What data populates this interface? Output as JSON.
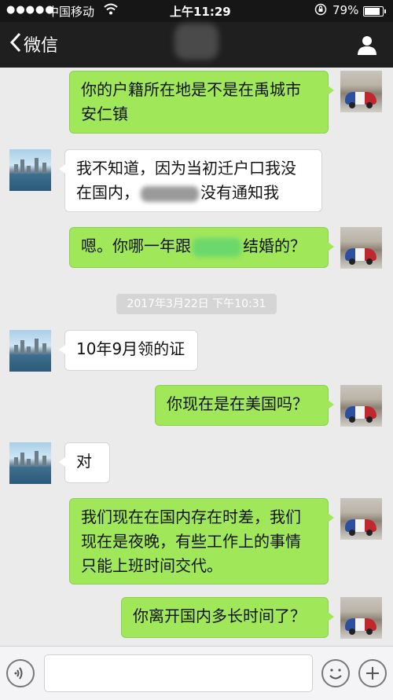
{
  "status_bar": {
    "signal": "●●●●●",
    "carrier": "中国移动",
    "time": "上午11:29",
    "battery": "79%"
  },
  "nav": {
    "back_label": "微信",
    "back_icon": "chevron-left-icon",
    "profile_icon": "person-icon"
  },
  "messages": [
    {
      "from": "me",
      "lines": [
        "你的户籍所在地是不是在禹城市",
        "安仁镇"
      ]
    },
    {
      "from": "other",
      "line1": "我不知道，因为当初迁户口我没",
      "line2_pre": "在国内，",
      "line2_post": "没有通知我"
    },
    {
      "from": "me",
      "pre": "嗯。你哪一年跟",
      "post": "结婚的？"
    },
    {
      "from": "other",
      "text": "10年9月领的证"
    },
    {
      "from": "me",
      "text": "你现在是在美国吗？"
    },
    {
      "from": "other",
      "text": "对"
    },
    {
      "from": "me",
      "lines": [
        "我们现在在国内存在时差，我们",
        "现在是夜晚，有些工作上的事情",
        "只能上班时间交代。"
      ]
    },
    {
      "from": "me",
      "text": "你离开国内多长时间了？"
    }
  ],
  "timestamp": "2017年3月22日  下午10:31",
  "colors": {
    "me_bubble": "#a0e75a",
    "other_bubble": "#ffffff",
    "chat_bg": "#ebebeb",
    "nav_bg": "#1f1f1f"
  }
}
